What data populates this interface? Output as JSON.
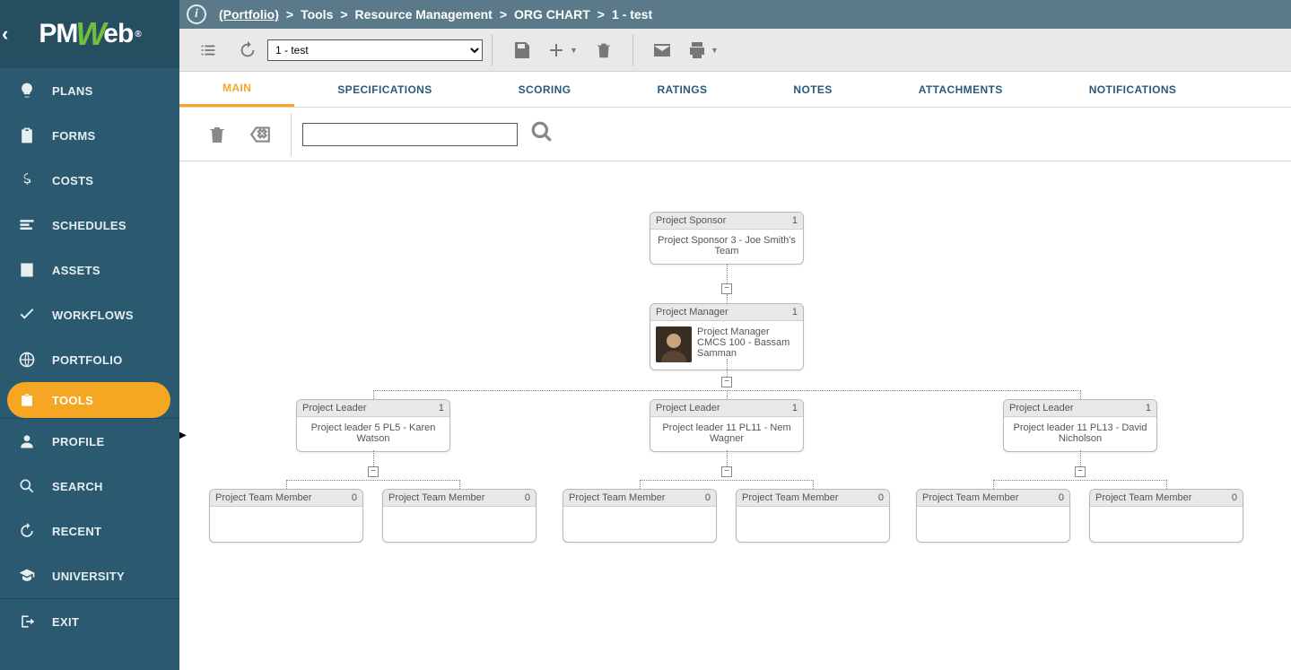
{
  "breadcrumb": {
    "root": "(Portfolio)",
    "parts": [
      "Tools",
      "Resource Management",
      "ORG CHART",
      "1 - test"
    ]
  },
  "sidebar": {
    "items": [
      {
        "label": "PLANS"
      },
      {
        "label": "FORMS"
      },
      {
        "label": "COSTS"
      },
      {
        "label": "SCHEDULES"
      },
      {
        "label": "ASSETS"
      },
      {
        "label": "WORKFLOWS"
      },
      {
        "label": "PORTFOLIO"
      },
      {
        "label": "TOOLS"
      }
    ],
    "items2": [
      {
        "label": "PROFILE"
      },
      {
        "label": "SEARCH"
      },
      {
        "label": "RECENT"
      },
      {
        "label": "UNIVERSITY"
      }
    ],
    "exit": "EXIT"
  },
  "toolbar": {
    "record_selected": "1 -  test"
  },
  "tabs": [
    {
      "label": "MAIN"
    },
    {
      "label": "SPECIFICATIONS"
    },
    {
      "label": "SCORING"
    },
    {
      "label": "RATINGS"
    },
    {
      "label": "NOTES"
    },
    {
      "label": "ATTACHMENTS"
    },
    {
      "label": "NOTIFICATIONS"
    }
  ],
  "search": {
    "value": ""
  },
  "org": {
    "sponsor": {
      "title": "Project Sponsor",
      "count": "1",
      "text": "Project Sponsor 3 - Joe Smith's Team"
    },
    "manager": {
      "title": "Project Manager",
      "count": "1",
      "text": "Project Manager CMCS 100 - Bassam Samman"
    },
    "leaders": [
      {
        "title": "Project Leader",
        "count": "1",
        "text": "Project leader 5 PL5 - Karen Watson"
      },
      {
        "title": "Project Leader",
        "count": "1",
        "text": "Project leader 11 PL11 - Nem Wagner"
      },
      {
        "title": "Project Leader",
        "count": "1",
        "text": "Project leader 11 PL13 - David Nicholson"
      }
    ],
    "members": [
      {
        "title": "Project Team Member",
        "count": "0"
      },
      {
        "title": "Project Team Member",
        "count": "0"
      },
      {
        "title": "Project Team Member",
        "count": "0"
      },
      {
        "title": "Project Team Member",
        "count": "0"
      },
      {
        "title": "Project Team Member",
        "count": "0"
      },
      {
        "title": "Project Team Member",
        "count": "0"
      }
    ]
  }
}
